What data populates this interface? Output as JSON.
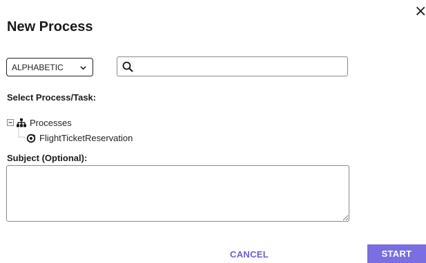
{
  "dialog": {
    "title": "New Process",
    "close_label": "×"
  },
  "filter": {
    "sort_selected": "ALPHABETIC",
    "sort_icon": "chevron-down-icon",
    "search_placeholder": "",
    "search_value": "",
    "search_icon": "search-icon"
  },
  "tree": {
    "label": "Select Process/Task:",
    "root": {
      "label": "Processes",
      "icon": "sitemap-icon",
      "expander_icon": "collapse-minus-icon"
    },
    "children": [
      {
        "label": "FlightTicketReservation",
        "icon": "process-cycle-icon"
      }
    ]
  },
  "subject": {
    "label": "Subject (Optional):",
    "value": ""
  },
  "actions": {
    "cancel_label": "CANCEL",
    "start_label": "START"
  },
  "colors": {
    "accent": "#7a6ee0",
    "cancel_text": "#6a5ecf",
    "text": "#1a1a1a"
  }
}
